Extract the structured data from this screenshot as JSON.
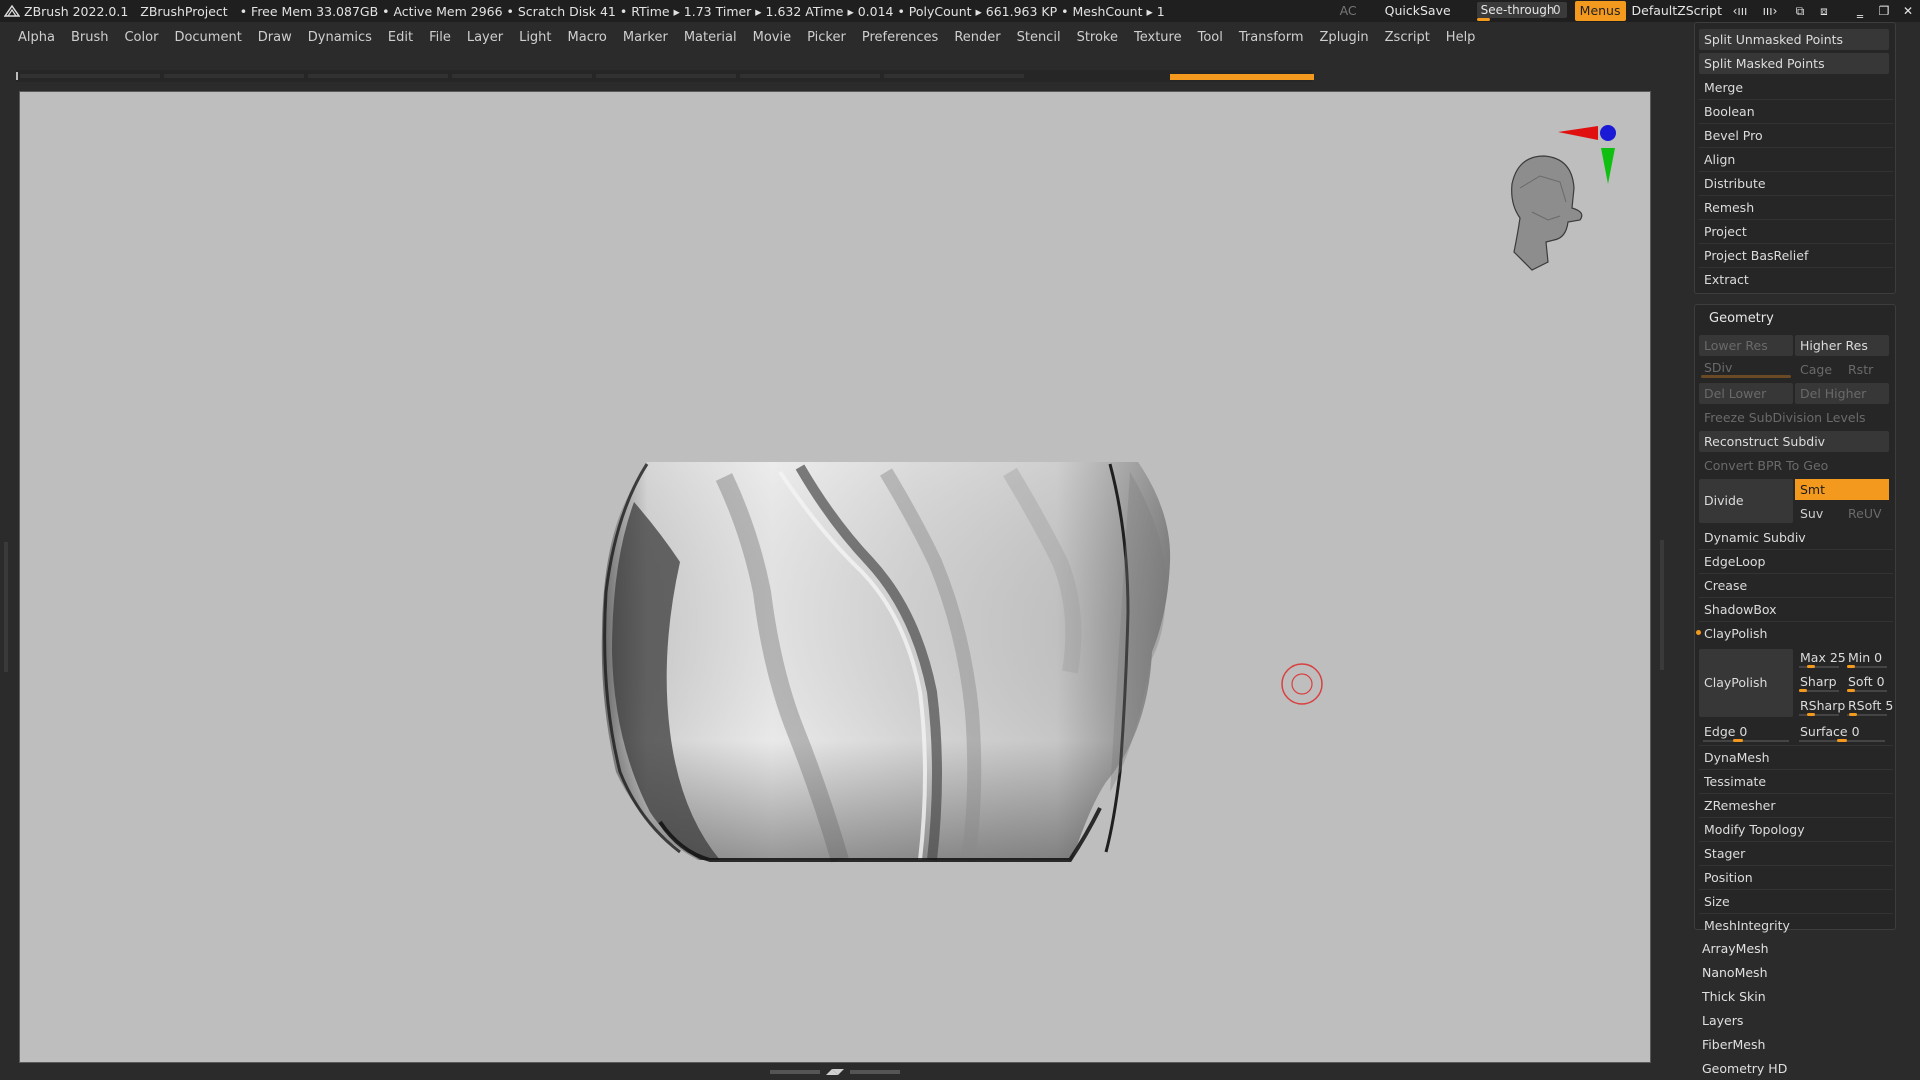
{
  "app": {
    "title": "ZBrush 2022.0.1",
    "project": "ZBrushProject",
    "stats": "• Free Mem 33.087GB • Active Mem 2966 • Scratch Disk 41 • RTime ▸ 1.73 Timer ▸ 1.632 ATime ▸ 0.014 • PolyCount ▸ 661.963 KP • MeshCount ▸ 1"
  },
  "titlebar": {
    "ac": "AC",
    "quicksave": "QuickSave",
    "see_through_label": "See-through",
    "see_through_value": "0",
    "see_through_fraction": 0.14,
    "menus": "Menus",
    "script": "DefaultZScript"
  },
  "menubar": [
    "Alpha",
    "Brush",
    "Color",
    "Document",
    "Draw",
    "Dynamics",
    "Edit",
    "File",
    "Layer",
    "Light",
    "Macro",
    "Marker",
    "Material",
    "Movie",
    "Picker",
    "Preferences",
    "Render",
    "Stencil",
    "Stroke",
    "Texture",
    "Tool",
    "Transform",
    "Zplugin",
    "Zscript",
    "Help"
  ],
  "subtool_panel": {
    "split_unmasked": "Split Unmasked Points",
    "split_masked": "Split Masked Points",
    "merge": "Merge",
    "boolean": "Boolean",
    "bevel_pro": "Bevel Pro",
    "align": "Align",
    "distribute": "Distribute",
    "remesh": "Remesh",
    "project": "Project",
    "project_basrelief": "Project BasRelief",
    "extract": "Extract"
  },
  "geometry": {
    "title": "Geometry",
    "lower_res": "Lower Res",
    "higher_res": "Higher Res",
    "sdiv": "SDiv",
    "cage": "Cage",
    "rstr": "Rstr",
    "del_lower": "Del Lower",
    "del_higher": "Del Higher",
    "freeze": "Freeze SubDivision Levels",
    "reconstruct": "Reconstruct Subdiv",
    "convert_bpr": "Convert BPR To Geo",
    "divide": "Divide",
    "smt": "Smt",
    "suv": "Suv",
    "reuv": "ReUV",
    "dynamic_subdiv": "Dynamic Subdiv",
    "edgeloop": "EdgeLoop",
    "crease": "Crease",
    "shadowbox": "ShadowBox",
    "claypolish_header": "ClayPolish",
    "claypolish_btn": "ClayPolish",
    "max": "Max 25",
    "min": "Min 0",
    "sharp": "Sharp",
    "soft": "Soft 0",
    "rsharp": "RSharp",
    "rsoft": "RSoft 5",
    "edge": "Edge 0",
    "surface": "Surface 0",
    "dynamesh": "DynaMesh",
    "tessimate": "Tessimate",
    "zremesher": "ZRemesher",
    "modify_topology": "Modify Topology",
    "stager": "Stager",
    "position": "Position",
    "size": "Size",
    "meshintegrity": "MeshIntegrity"
  },
  "more_panels": [
    "ArrayMesh",
    "NanoMesh",
    "Thick Skin",
    "Layers",
    "FiberMesh",
    "Geometry HD"
  ],
  "colors": {
    "accent": "#f39a1e",
    "viewport_bg": "#bebebe",
    "ui_bg": "#2b2b2b"
  }
}
